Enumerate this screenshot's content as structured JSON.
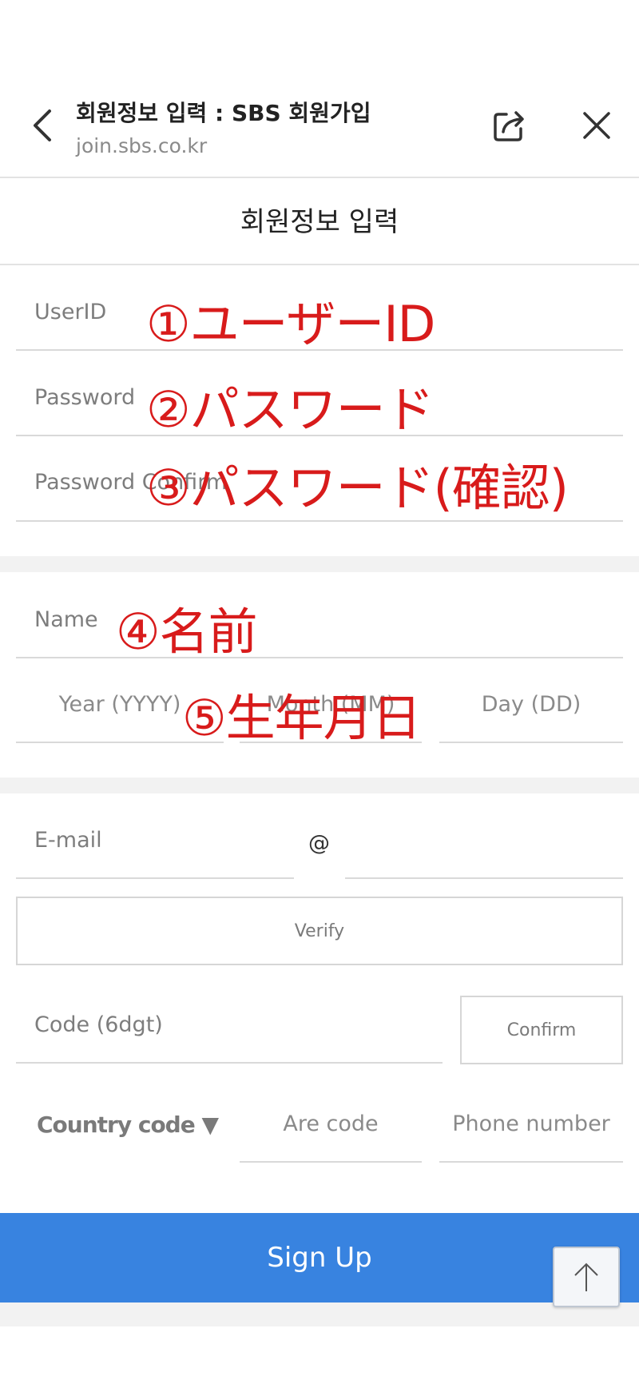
{
  "header": {
    "title": "회원정보 입력 : SBS 회원가입",
    "url": "join.sbs.co.kr"
  },
  "page": {
    "title": "회원정보 입력"
  },
  "account": {
    "userid_label": "UserID",
    "password_label": "Password",
    "password_confirm_label": "Password Confirm"
  },
  "personal": {
    "name_label": "Name",
    "year_placeholder": "Year (YYYY)",
    "month_placeholder": "Month (MM)",
    "day_placeholder": "Day (DD)"
  },
  "contact": {
    "email_label": "E-mail",
    "at_symbol": "@",
    "verify_label": "Verify",
    "code_label": "Code (6dgt)",
    "confirm_label": "Confirm",
    "country_code_label": "Country code ▼",
    "area_code_placeholder": "Are code",
    "phone_placeholder": "Phone number"
  },
  "signup_label": "Sign Up",
  "annotations": {
    "a1": "①ユーザーID",
    "a2": "②パスワード",
    "a3": "③パスワード(確認)",
    "a4": "④名前",
    "a5": "⑤生年月日"
  },
  "colors": {
    "accent": "#3883e0",
    "annotation": "#d81b1b"
  }
}
